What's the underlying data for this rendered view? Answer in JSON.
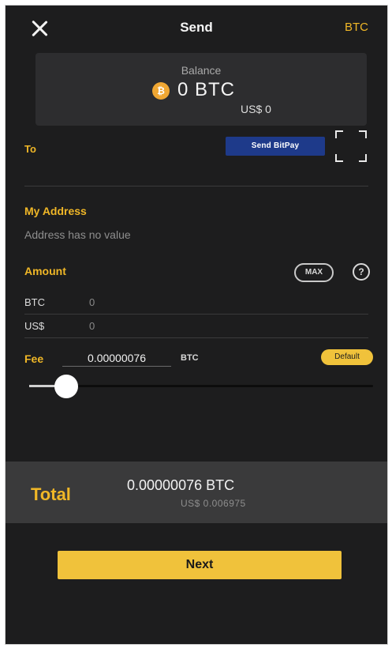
{
  "header": {
    "title": "Send",
    "currency": "BTC"
  },
  "balance": {
    "label": "Balance",
    "coin_symbol": "₿",
    "amount": "0 BTC",
    "fiat": "US$ 0"
  },
  "recipient": {
    "to_label": "To",
    "bitpay_button": "Send BitPay"
  },
  "my_address": {
    "label": "My Address",
    "value": "Address has no value"
  },
  "amount": {
    "label": "Amount",
    "max_label": "MAX",
    "help_glyph": "?",
    "btc_label": "BTC",
    "btc_value": "0",
    "fiat_label": "US$",
    "fiat_value": "0"
  },
  "fee": {
    "label": "Fee",
    "value": "0.00000076",
    "unit": "BTC",
    "default_label": "Default",
    "slider_level": 0.1
  },
  "total": {
    "label": "Total",
    "btc": "0.00000076 BTC",
    "fiat": "US$ 0.006975"
  },
  "actions": {
    "next_label": "Next"
  },
  "colors": {
    "accent": "#f0b727",
    "background": "#1d1d1e",
    "button": "#f0c23b",
    "bitpay": "#1e3a8a"
  }
}
